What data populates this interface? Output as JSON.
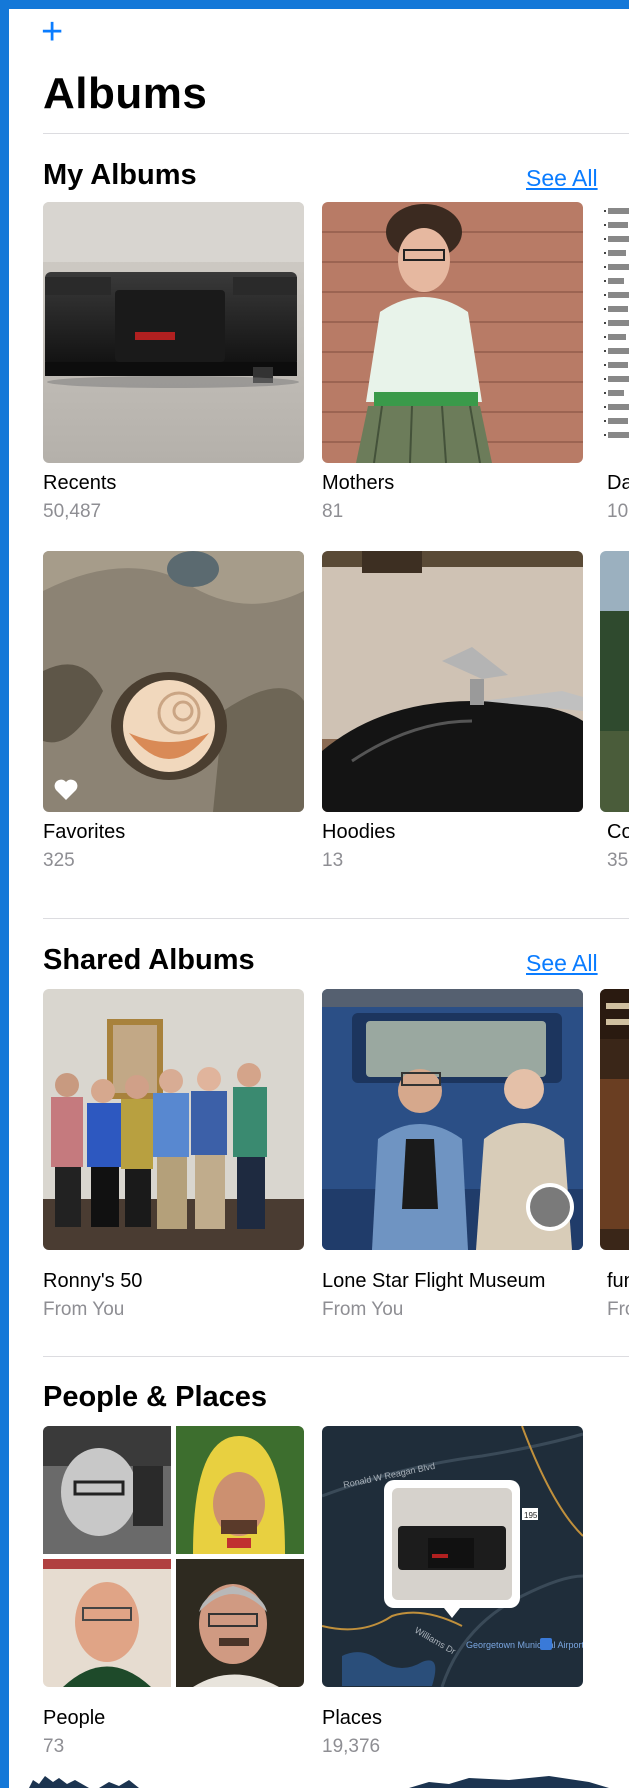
{
  "header": {
    "add_icon": "plus-icon",
    "title": "Albums"
  },
  "my_albums": {
    "title": "My Albums",
    "see_all": "See All",
    "row1": [
      {
        "name": "Recents",
        "count": "50,487"
      },
      {
        "name": "Mothers",
        "count": "81"
      },
      {
        "name": "Dar",
        "count": "10"
      }
    ],
    "row2": [
      {
        "name": "Favorites",
        "count": "325"
      },
      {
        "name": "Hoodies",
        "count": "13"
      },
      {
        "name": "Col",
        "count": "35"
      }
    ]
  },
  "shared_albums": {
    "title": "Shared Albums",
    "see_all": "See All",
    "items": [
      {
        "name": "Ronny's 50",
        "sub": "From You"
      },
      {
        "name": "Lone Star Flight Museum",
        "sub": "From You"
      },
      {
        "name": "fun",
        "sub": "Fro"
      }
    ]
  },
  "people_places": {
    "title": "People & Places",
    "people": {
      "name": "People",
      "count": "73"
    },
    "places": {
      "name": "Places",
      "count": "19,376"
    },
    "map_labels": {
      "road1": "Ronald W Reagan Blvd",
      "road2": "Williams Dr",
      "airport": "Georgetown Municipal Airport",
      "route": "195"
    }
  },
  "colors": {
    "accent": "#0a7cff",
    "secondary_text": "#8e8e93",
    "frame": "#1478d8"
  }
}
